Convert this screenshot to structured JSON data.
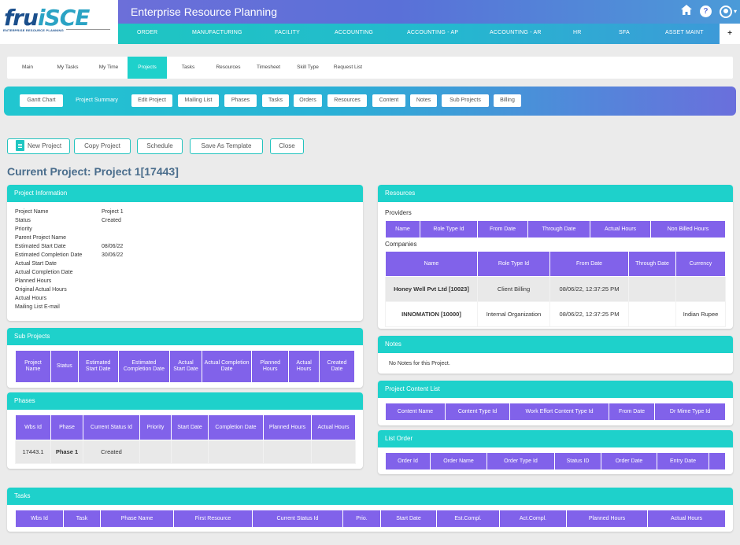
{
  "logo": {
    "text_main": "fru",
    "text_accent": "iSCE",
    "subtitle": "ENTERPRISE RESOURCE PLANNING"
  },
  "header": {
    "app_title": "Enterprise Resource Planning",
    "icons": [
      "home-icon",
      "help-icon",
      "user-account-icon"
    ],
    "caret": "▾"
  },
  "menu": {
    "items": [
      "ORDER",
      "MANUFACTURING",
      "FACILITY",
      "ACCOUNTING",
      "ACCOUNTING - AP",
      "ACCOUNTING - AR",
      "HR",
      "SFA",
      "ASSET MAINT"
    ],
    "plus": "+"
  },
  "subtabs": {
    "items": [
      "Main",
      "My Tasks",
      "My Time",
      "Projects",
      "Tasks",
      "Resources",
      "Timesheet",
      "Skill Type",
      "Request List"
    ],
    "active": "Projects"
  },
  "section_bar": {
    "items": [
      "Gantt Chart",
      "Project Summary",
      "Edit Project",
      "Mailing List",
      "Phases",
      "Tasks",
      "Orders",
      "Resources",
      "Content",
      "Notes",
      "Sub Projects",
      "Billing"
    ],
    "active": "Project Summary"
  },
  "actions": {
    "new_project": "New Project",
    "copy_project": "Copy Project",
    "schedule": "Schedule",
    "save_as_template": "Save As Template",
    "close": "Close"
  },
  "page_title": "Current Project: Project 1[17443]",
  "project_info": {
    "title": "Project Information",
    "rows": [
      {
        "label": "Project Name",
        "value": "Project 1"
      },
      {
        "label": "Status",
        "value": "Created"
      },
      {
        "label": "Priority",
        "value": ""
      },
      {
        "label": "Parent Project Name",
        "value": ""
      },
      {
        "label": "Estimated Start Date",
        "value": "08/06/22"
      },
      {
        "label": "Estimated Completion Date",
        "value": "30/06/22"
      },
      {
        "label": "Actual Start Date",
        "value": ""
      },
      {
        "label": "Actual Completion Date",
        "value": ""
      },
      {
        "label": "Planned Hours",
        "value": ""
      },
      {
        "label": "Original Actual Hours",
        "value": ""
      },
      {
        "label": "Actual Hours",
        "value": ""
      },
      {
        "label": "Mailing List E-mail",
        "value": ""
      }
    ]
  },
  "sub_projects": {
    "title": "Sub Projects",
    "columns": [
      "Project Name",
      "Status",
      "Estimated Start Date",
      "Estimated Completion Date",
      "Actual Start Date",
      "Actual Completion Date",
      "Planned Hours",
      "Actual Hours",
      "Created Date"
    ]
  },
  "phases": {
    "title": "Phases",
    "columns": [
      "Wbs Id",
      "Phase",
      "Current Status Id",
      "Priority",
      "Start Date",
      "Completion Date",
      "Planned Hours",
      "Actual Hours"
    ],
    "rows": [
      [
        "17443.1",
        "Phase 1",
        "Created",
        "",
        "",
        "",
        "",
        ""
      ]
    ]
  },
  "resources": {
    "title": "Resources",
    "providers_label": "Providers",
    "providers_columns": [
      "Name",
      "Role Type Id",
      "From Date",
      "Through Date",
      "Actual Hours",
      "Non Billed Hours"
    ],
    "companies_label": "Companies",
    "companies_columns": [
      "Name",
      "Role Type Id",
      "From Date",
      "Through Date",
      "Currency"
    ],
    "companies_rows": [
      [
        "Honey Well Pvt Ltd [10023]",
        "Client Billing",
        "08/06/22, 12:37:25 PM",
        "",
        ""
      ],
      [
        "INNOMATION [10000]",
        "Internal Organization",
        "08/06/22, 12:37:25 PM",
        "",
        "Indian Rupee"
      ]
    ]
  },
  "notes": {
    "title": "Notes",
    "text": "No Notes for this Project."
  },
  "content_list": {
    "title": "Project Content List",
    "columns": [
      "Content Name",
      "Content Type Id",
      "Work Effort Content Type Id",
      "From Date",
      "Dr Mime Type Id"
    ]
  },
  "list_order": {
    "title": "List Order",
    "columns": [
      "Order Id",
      "Order Name",
      "Order Type Id",
      "Status ID",
      "Order Date",
      "Entry Date",
      ""
    ]
  },
  "tasks": {
    "title": "Tasks",
    "columns": [
      "Wbs Id",
      "Task",
      "Phase Name",
      "First Resource",
      "Current Status Id",
      "Prio.",
      "Start Date",
      "Est.Compl.",
      "Act.Compl.",
      "Planned Hours",
      "Actual Hours"
    ]
  },
  "colors": {
    "teal": "#1ed1cb",
    "purple": "#8162ea",
    "title_blue": "#4a6d8c"
  }
}
